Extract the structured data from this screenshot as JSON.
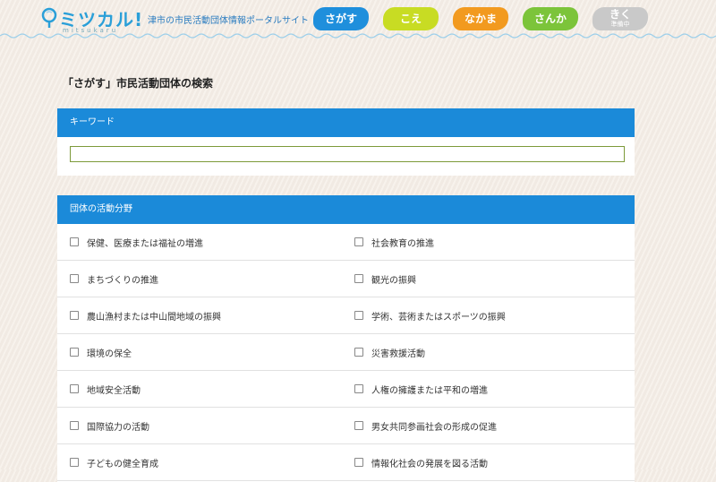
{
  "header": {
    "logo_text": "ミツカル!",
    "logo_roman": "mitsukaru",
    "tagline": "津市の市民活動団体情報ポータルサイト",
    "nav": [
      {
        "label": "さがす",
        "color": "#1f8fdc"
      },
      {
        "label": "こえ",
        "color": "#c8dc23"
      },
      {
        "label": "なかま",
        "color": "#f29a1f"
      },
      {
        "label": "さんか",
        "color": "#7cc43a"
      },
      {
        "label": "きく",
        "sub": "準備中",
        "color": "#c9c9c9"
      }
    ]
  },
  "page": {
    "title": "「さがす」市民活動団体の検索"
  },
  "keyword": {
    "heading": "キーワード",
    "value": "",
    "placeholder": ""
  },
  "categories": {
    "heading": "団体の活動分野",
    "rows": [
      [
        "保健、医療または福祉の増進",
        "社会教育の推進"
      ],
      [
        "まちづくりの推進",
        "観光の振興"
      ],
      [
        "農山漁村または中山間地域の振興",
        "学術、芸術またはスポーツの振興"
      ],
      [
        "環境の保全",
        "災害救援活動"
      ],
      [
        "地域安全活動",
        "人権の擁護または平和の増進"
      ],
      [
        "国際協力の活動",
        "男女共同参画社会の形成の促進"
      ],
      [
        "子どもの健全育成",
        "情報化社会の発展を図る活動"
      ]
    ]
  }
}
